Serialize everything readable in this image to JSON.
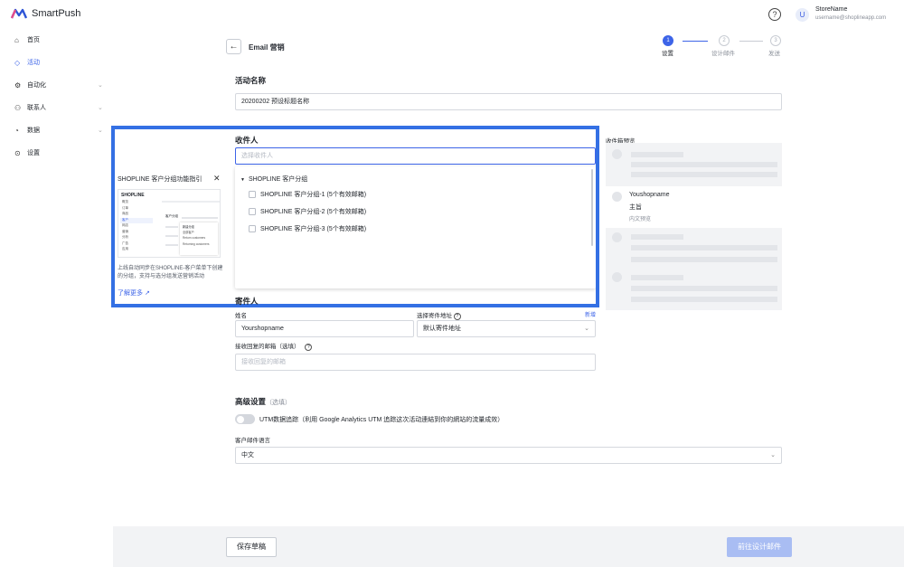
{
  "app": {
    "name": "SmartPush"
  },
  "user": {
    "avatar_letter": "U",
    "store_name": "StoreName",
    "email": "username@shoplineapp.com"
  },
  "sidebar": {
    "items": [
      {
        "label": "首页",
        "icon": "home-icon",
        "glyph": "⌂"
      },
      {
        "label": "活动",
        "icon": "tag-icon",
        "glyph": "◇",
        "active": true
      },
      {
        "label": "自动化",
        "icon": "automation-icon",
        "glyph": "⚙"
      },
      {
        "label": "联系人",
        "icon": "contact-icon",
        "glyph": "⚇"
      },
      {
        "label": "数据",
        "icon": "chart-icon",
        "glyph": "◔"
      },
      {
        "label": "设置",
        "icon": "settings-icon",
        "glyph": "⊙"
      }
    ]
  },
  "header": {
    "back": "←",
    "title": "Email 营销"
  },
  "steps": [
    {
      "num": "1",
      "label": "设置"
    },
    {
      "num": "2",
      "label": "设计邮件"
    },
    {
      "num": "3",
      "label": "发送"
    }
  ],
  "campaign": {
    "label": "活动名称",
    "value": "20200202 预设标题名称"
  },
  "recipients": {
    "label": "收件人",
    "placeholder": "选择收件人",
    "group": "SHOPLINE 客户分组",
    "options": [
      "SHOPLINE 客户分组-1 (5个有效邮箱)",
      "SHOPLINE 客户分组-2 (5个有效邮箱)",
      "SHOPLINE 客户分组-3 (5个有效邮箱)"
    ]
  },
  "guide": {
    "title": "SHOPLINE 客户分组功能指引",
    "close": "✕",
    "description": "上线自动同步在SHOPLINE-客户菜单下创建的分组，支持与选分组发送营销活动",
    "link": "了解更多",
    "thumb_logo": "SHOPLINE",
    "thumb_menu": [
      "概览",
      "订单",
      "商品",
      "客户",
      "网店",
      "营销",
      "分析",
      "广告",
      "应用"
    ],
    "thumb_label": "客户分组",
    "thumb_popup": [
      "新建分组",
      "全部客户",
      "Return customers",
      "Returning customers"
    ]
  },
  "sender": {
    "label": "寄件人",
    "name_label": "姓名",
    "name_value": "Yourshopname",
    "address_label": "选择寄件地址",
    "address_value": "默认寄件地址",
    "add_link": "新增",
    "reply_label": "接收回复的邮箱（选填）",
    "reply_placeholder": "接收回复的邮箱"
  },
  "advanced": {
    "label": "高级设置",
    "optional": "（选填）",
    "utm_label": "UTM数据追踪（利用 Google Analytics UTM 追踪这次活动連結到你的網站的流量成效）",
    "language_label": "客户邮件语言",
    "language_value": "中文"
  },
  "preview": {
    "title": "收件箱预览",
    "sender": "Youshopname",
    "subject": "主旨",
    "preview_text": "内文预览"
  },
  "footer": {
    "save": "保存草稿",
    "next": "前往设计邮件"
  },
  "colors": {
    "primary": "#3d64e8",
    "highlight": "#3470e4",
    "next_disabled": "#a9bdf3"
  }
}
